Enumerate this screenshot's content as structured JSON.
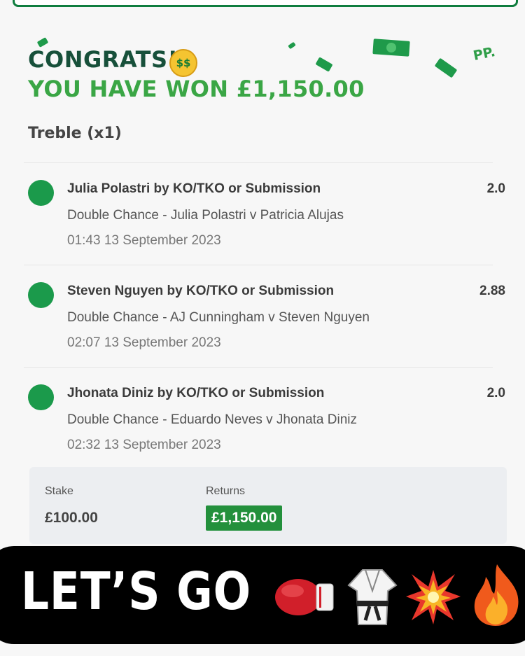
{
  "hero": {
    "congrats": "CONGRATS!",
    "won_text": "YOU HAVE WON £1,150.00",
    "emoji_money_face": "$$",
    "logo": "PP.",
    "bet_type": "Treble (x1)"
  },
  "selections": [
    {
      "title": "Julia Polastri by KO/TKO or Submission",
      "odds": "2.0",
      "market": "Double Chance - Julia Polastri v Patricia Alujas",
      "datetime": "01:43 13 September 2023",
      "status_icon": "won-indicator"
    },
    {
      "title": "Steven Nguyen by KO/TKO or Submission",
      "odds": "2.88",
      "market": "Double Chance - AJ Cunningham v Steven Nguyen",
      "datetime": "02:07 13 September 2023",
      "status_icon": "won-indicator"
    },
    {
      "title": "Jhonata Diniz by KO/TKO or Submission",
      "odds": "2.0",
      "market": "Double Chance - Eduardo Neves v Jhonata Diniz",
      "datetime": "02:32 13 September 2023",
      "status_icon": "won-indicator"
    }
  ],
  "summary": {
    "stake_label": "Stake",
    "stake_value": "£100.00",
    "returns_label": "Returns",
    "returns_value": "£1,150.00"
  },
  "banner": {
    "text": "LET’S GO",
    "emojis": [
      "boxing-glove-icon",
      "martial-arts-uniform-icon",
      "collision-icon",
      "fire-icon"
    ]
  },
  "colors": {
    "brand_dark_green": "#17503a",
    "brand_green": "#3aa645",
    "won_dot": "#1b9a4b",
    "returns_badge": "#23903c"
  }
}
